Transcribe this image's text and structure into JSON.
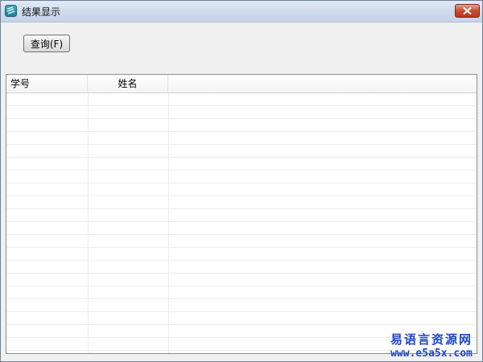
{
  "window": {
    "title": "结果显示",
    "close_icon": "close-icon",
    "app_icon": "app-icon"
  },
  "toolbar": {
    "query_label": "查询(F)"
  },
  "table": {
    "columns": [
      "学号",
      "姓名",
      ""
    ],
    "rows": []
  },
  "watermark": {
    "line1": "易语言资源网",
    "line2": "www.e5a5x.com"
  },
  "colors": {
    "close_button": "#c94a32",
    "watermark": "#1e46c8",
    "titlebar": "#cfdaeb"
  }
}
